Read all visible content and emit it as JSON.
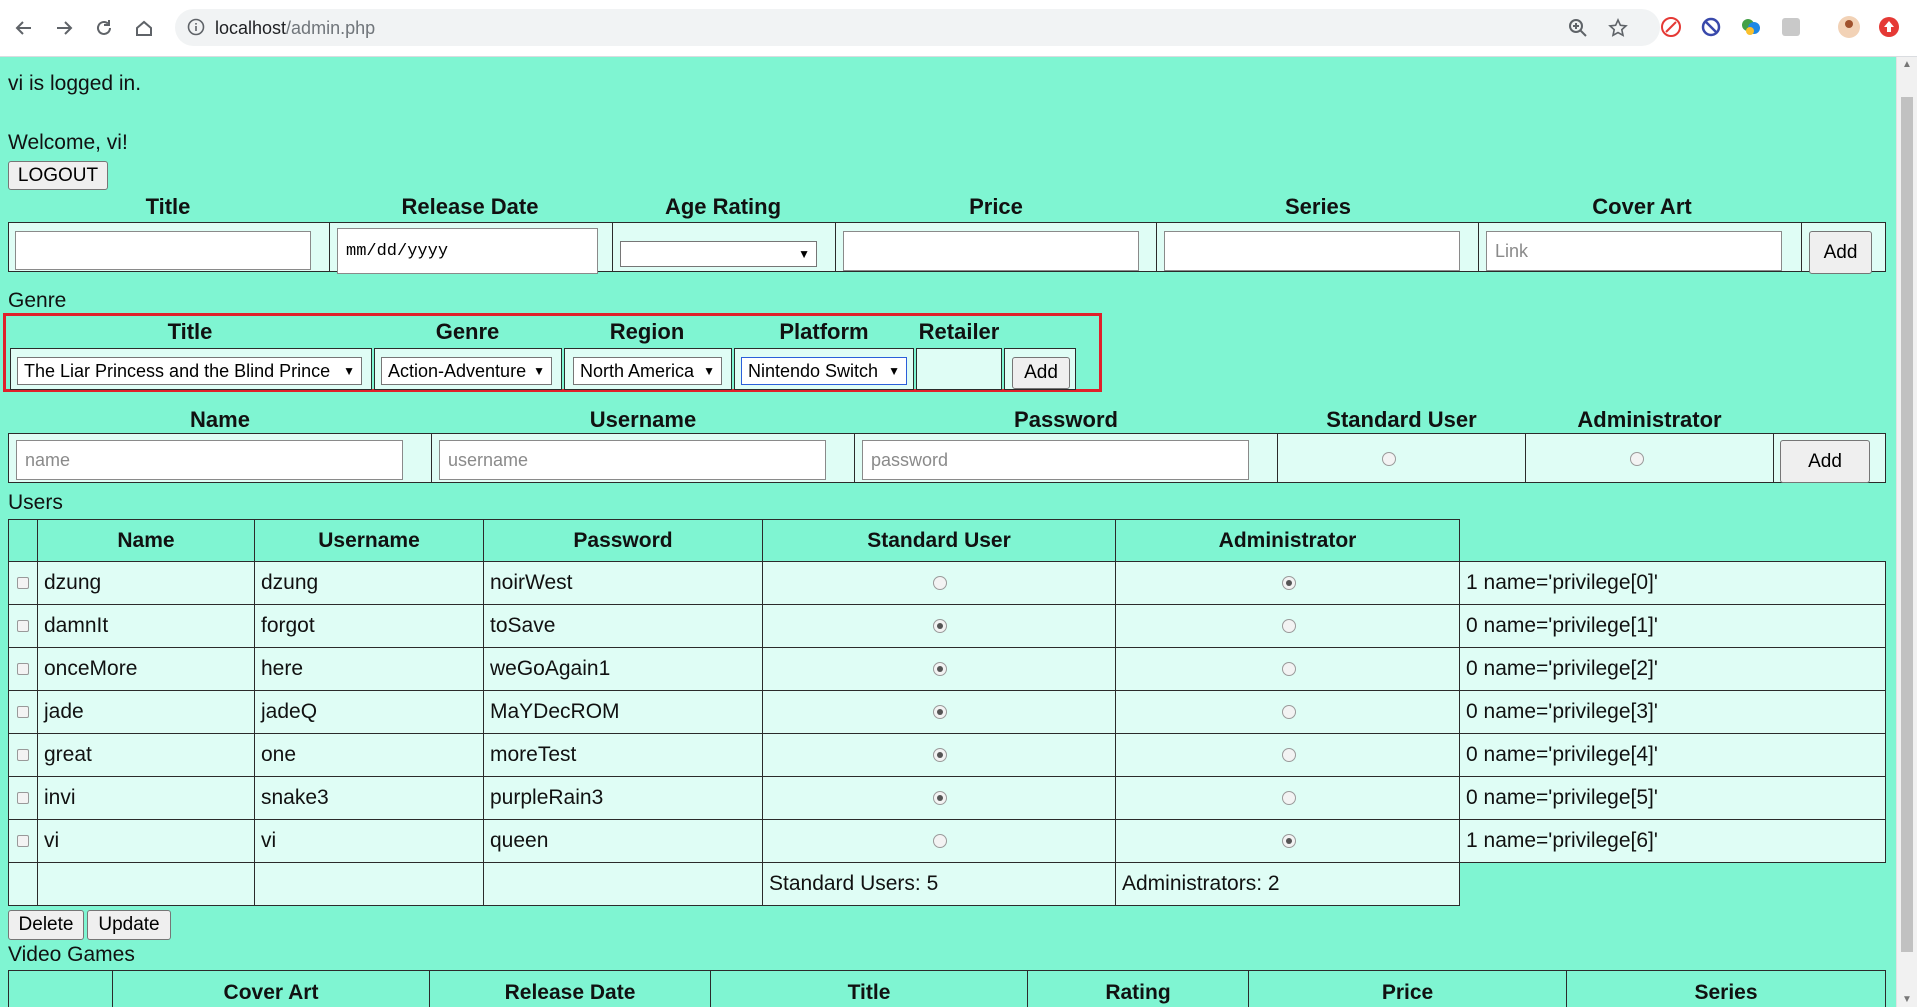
{
  "browser": {
    "url_host": "localhost",
    "url_path": "/admin.php"
  },
  "status": {
    "logged_in": "vi is logged in.",
    "welcome": "Welcome, vi!",
    "logout": "LOGOUT"
  },
  "game_form": {
    "headers": [
      "Title",
      "Release Date",
      "Age Rating",
      "Price",
      "Series",
      "Cover Art"
    ],
    "date_placeholder": "mm/dd/yyyy",
    "cover_placeholder": "Link",
    "add": "Add"
  },
  "genre_label": "Genre",
  "genre_form": {
    "headers": [
      "Title",
      "Genre",
      "Region",
      "Platform",
      "Retailer"
    ],
    "title_value": "The Liar Princess and the Blind Prince",
    "genre_value": "Action-Adventure",
    "region_value": "North America",
    "platform_value": "Nintendo Switch",
    "add": "Add"
  },
  "user_form": {
    "headers": [
      "Name",
      "Username",
      "Password",
      "Standard User",
      "Administrator"
    ],
    "name_placeholder": "name",
    "username_placeholder": "username",
    "password_placeholder": "password",
    "add": "Add"
  },
  "users_label": "Users",
  "users_table": {
    "headers": [
      "Name",
      "Username",
      "Password",
      "Standard User",
      "Administrator"
    ],
    "rows": [
      {
        "name": "dzung",
        "username": "dzung",
        "password": "noirWest",
        "standard": false,
        "admin": true,
        "note": "1 name='privilege[0]'"
      },
      {
        "name": "damnIt",
        "username": "forgot",
        "password": "toSave",
        "standard": true,
        "admin": false,
        "note": "0 name='privilege[1]'"
      },
      {
        "name": "onceMore",
        "username": "here",
        "password": "weGoAgain1",
        "standard": true,
        "admin": false,
        "note": "0 name='privilege[2]'"
      },
      {
        "name": "jade",
        "username": "jadeQ",
        "password": "MaYDecROM",
        "standard": true,
        "admin": false,
        "note": "0 name='privilege[3]'"
      },
      {
        "name": "great",
        "username": "one",
        "password": "moreTest",
        "standard": true,
        "admin": false,
        "note": "0 name='privilege[4]'"
      },
      {
        "name": "invi",
        "username": "snake3",
        "password": "purpleRain3",
        "standard": true,
        "admin": false,
        "note": "0 name='privilege[5]'"
      },
      {
        "name": "vi",
        "username": "vi",
        "password": "queen",
        "standard": false,
        "admin": true,
        "note": "1 name='privilege[6]'"
      }
    ],
    "standard_count": "Standard Users: 5",
    "admin_count": "Administrators: 2"
  },
  "actions": {
    "delete": "Delete",
    "update": "Update"
  },
  "video_games_label": "Video Games",
  "games_table": {
    "headers": [
      "Cover Art",
      "Release Date",
      "Title",
      "Rating",
      "Price",
      "Series"
    ]
  },
  "icons": {
    "back": "back-arrow-icon",
    "forward": "forward-arrow-icon",
    "reload": "reload-icon",
    "home": "home-icon",
    "info": "info-icon",
    "zoom": "zoom-icon",
    "star": "star-icon"
  },
  "colors": {
    "page_bg": "#7ff5d2",
    "cell_bg": "#dffdf5",
    "highlight": "#e0202a"
  }
}
